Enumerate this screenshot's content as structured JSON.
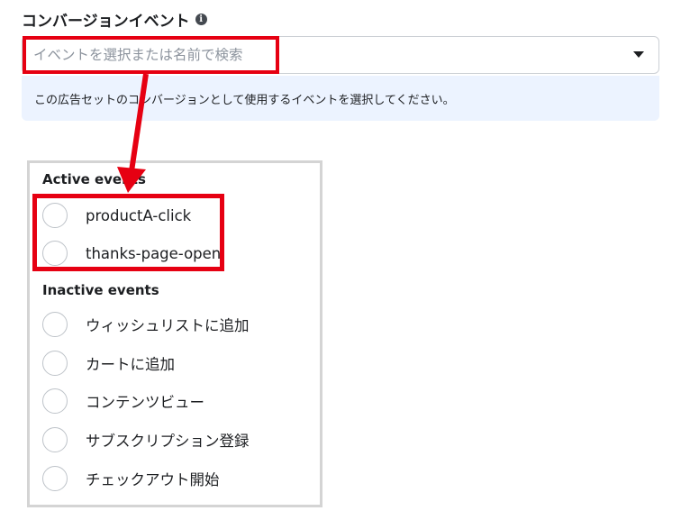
{
  "conversion_event": {
    "title": "コンバージョンイベント",
    "info_icon_glyph": "i",
    "search": {
      "value": "",
      "placeholder": "イベントを選択または名前で検索"
    },
    "help_text": "この広告セットのコンバージョンとして使用するイベントを選択してください。"
  },
  "dropdown": {
    "active_header": "Active events",
    "active_events": [
      {
        "label": "productA-click",
        "selected": false
      },
      {
        "label": "thanks-page-open",
        "selected": false
      }
    ],
    "inactive_header": "Inactive events",
    "inactive_events": [
      {
        "label": "ウィッシュリストに追加",
        "selected": false
      },
      {
        "label": "カートに追加",
        "selected": false
      },
      {
        "label": "コンテンツビュー",
        "selected": false
      },
      {
        "label": "サブスクリプション登録",
        "selected": false
      },
      {
        "label": "チェックアウト開始",
        "selected": false
      }
    ]
  },
  "colors": {
    "annotation_red": "#e60012",
    "help_bg": "#ecf3ff",
    "text": "#1c1e21",
    "placeholder": "#8d949e"
  }
}
